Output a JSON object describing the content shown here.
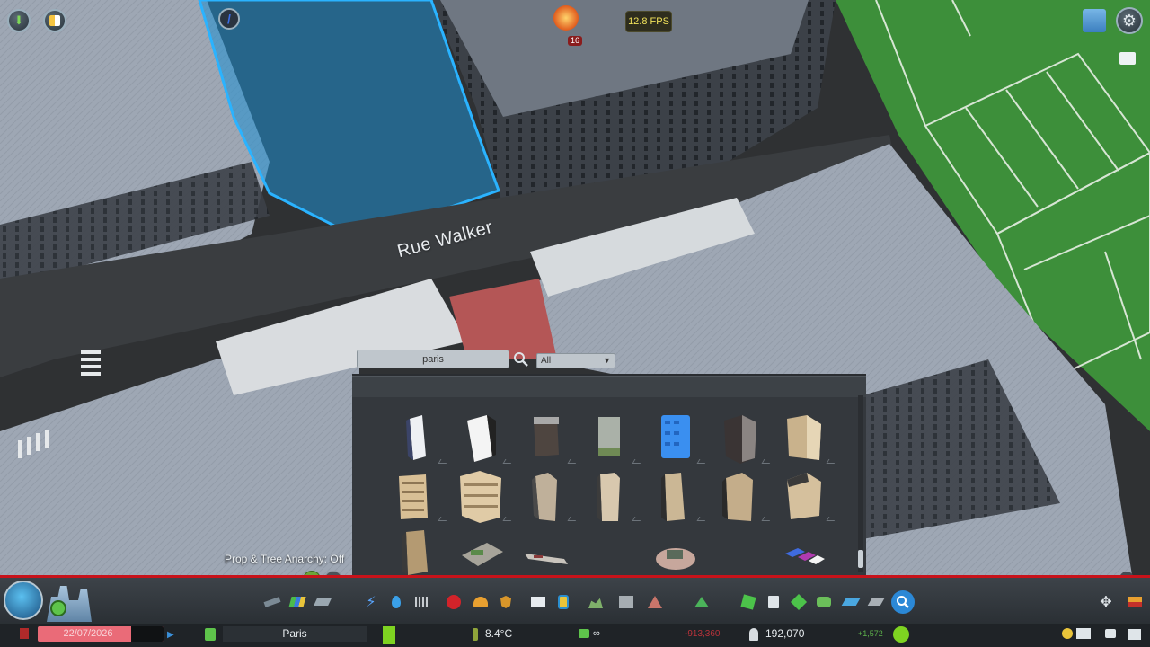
{
  "hud": {
    "fps": "12.8 FPS",
    "fire_count": "16",
    "street_name": "Rue Walker"
  },
  "find_it": {
    "search_value": "paris",
    "filter_selected": "All",
    "anarchy_status": "Prop & Tree Anarchy: Off"
  },
  "status": {
    "date": "22/07/2026",
    "city_name": "Paris",
    "temperature": "8.4°C",
    "cash": "∞",
    "expenses": "-913,360",
    "population": "192,070",
    "population_change": "+1,572"
  },
  "icons": {
    "top_left": [
      "unlock-icon",
      "info-views-icon",
      "advisor-icon"
    ],
    "top_right": [
      "city-icon",
      "settings-icon",
      "camera-icon"
    ],
    "toolbar": [
      "roads-icon",
      "zoning-icon",
      "districts-icon",
      "electricity-icon",
      "water-icon",
      "garbage-icon",
      "health-icon",
      "fire-icon",
      "police-icon",
      "education-icon",
      "transport-icon",
      "parks-icon",
      "unique-buildings-icon",
      "landscaping-icon",
      "economy-icon",
      "policies-icon",
      "monuments-icon",
      "wonders-icon",
      "find-it-icon",
      "move-it-icon",
      "bulldozer-icon"
    ]
  },
  "colors": {
    "selection": "#1f8fd1",
    "alert_line": "#c8121a",
    "date_bg": "#ea6b78",
    "grass": "#3d8f3a"
  }
}
